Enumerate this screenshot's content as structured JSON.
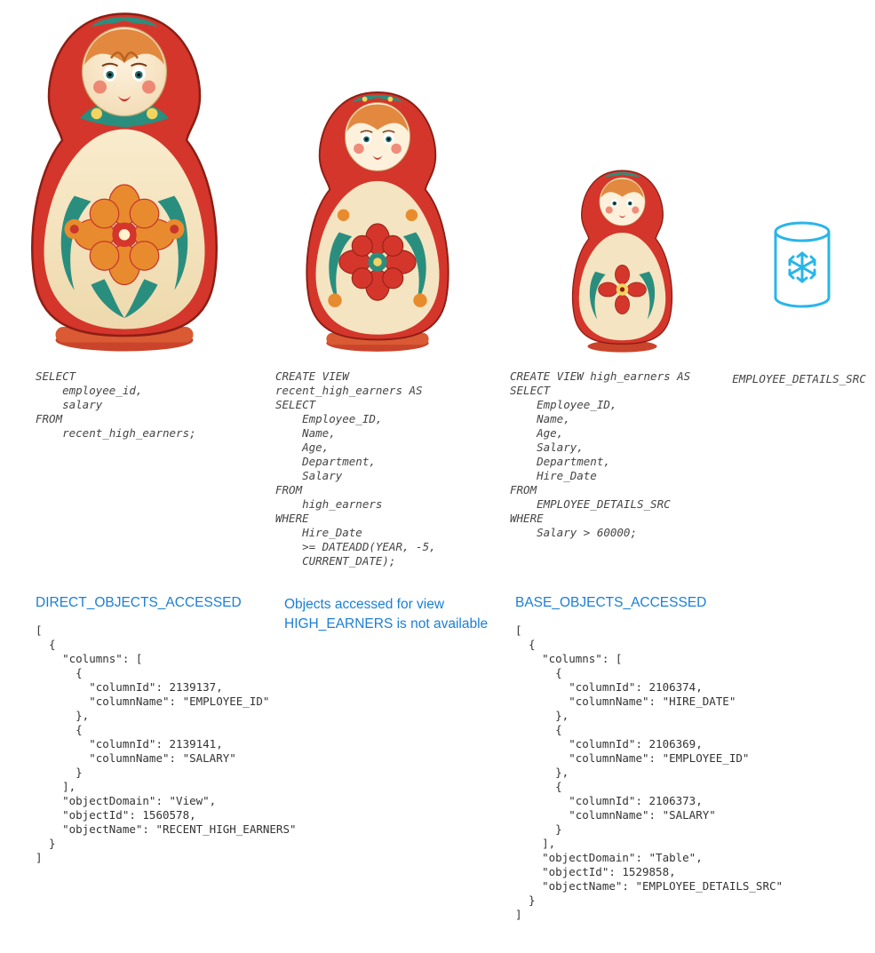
{
  "doll_size": {
    "large": 390,
    "medium": 300,
    "small": 210
  },
  "source_table_label": "EMPLOYEE_DETAILS_SRC",
  "sql": {
    "query": "SELECT\n    employee_id,\n    salary\nFROM\n    recent_high_earners;",
    "view2": "CREATE VIEW\nrecent_high_earners AS\nSELECT\n    Employee_ID,\n    Name,\n    Age,\n    Department,\n    Salary\nFROM\n    high_earners\nWHERE\n    Hire_Date\n    >= DATEADD(YEAR, -5,\n    CURRENT_DATE);",
    "view1": "CREATE VIEW high_earners AS\nSELECT\n    Employee_ID,\n    Name,\n    Age,\n    Salary,\n    Department,\n    Hire_Date\nFROM\n    EMPLOYEE_DETAILS_SRC\nWHERE\n    Salary > 60000;"
  },
  "headings": {
    "direct": "DIRECT_OBJECTS_ACCESSED",
    "middle_note": "Objects accessed for view HIGH_EARNERS is not available",
    "base": "BASE_OBJECTS_ACCESSED"
  },
  "direct_objects_json": "[\n  {\n    \"columns\": [\n      {\n        \"columnId\": 2139137,\n        \"columnName\": \"EMPLOYEE_ID\"\n      },\n      {\n        \"columnId\": 2139141,\n        \"columnName\": \"SALARY\"\n      }\n    ],\n    \"objectDomain\": \"View\",\n    \"objectId\": 1560578,\n    \"objectName\": \"RECENT_HIGH_EARNERS\"\n  }\n]",
  "base_objects_json": "[\n  {\n    \"columns\": [\n      {\n        \"columnId\": 2106374,\n        \"columnName\": \"HIRE_DATE\"\n      },\n      {\n        \"columnId\": 2106369,\n        \"columnName\": \"EMPLOYEE_ID\"\n      },\n      {\n        \"columnId\": 2106373,\n        \"columnName\": \"SALARY\"\n      }\n    ],\n    \"objectDomain\": \"Table\",\n    \"objectId\": 1529858,\n    \"objectName\": \"EMPLOYEE_DETAILS_SRC\"\n  }\n]"
}
